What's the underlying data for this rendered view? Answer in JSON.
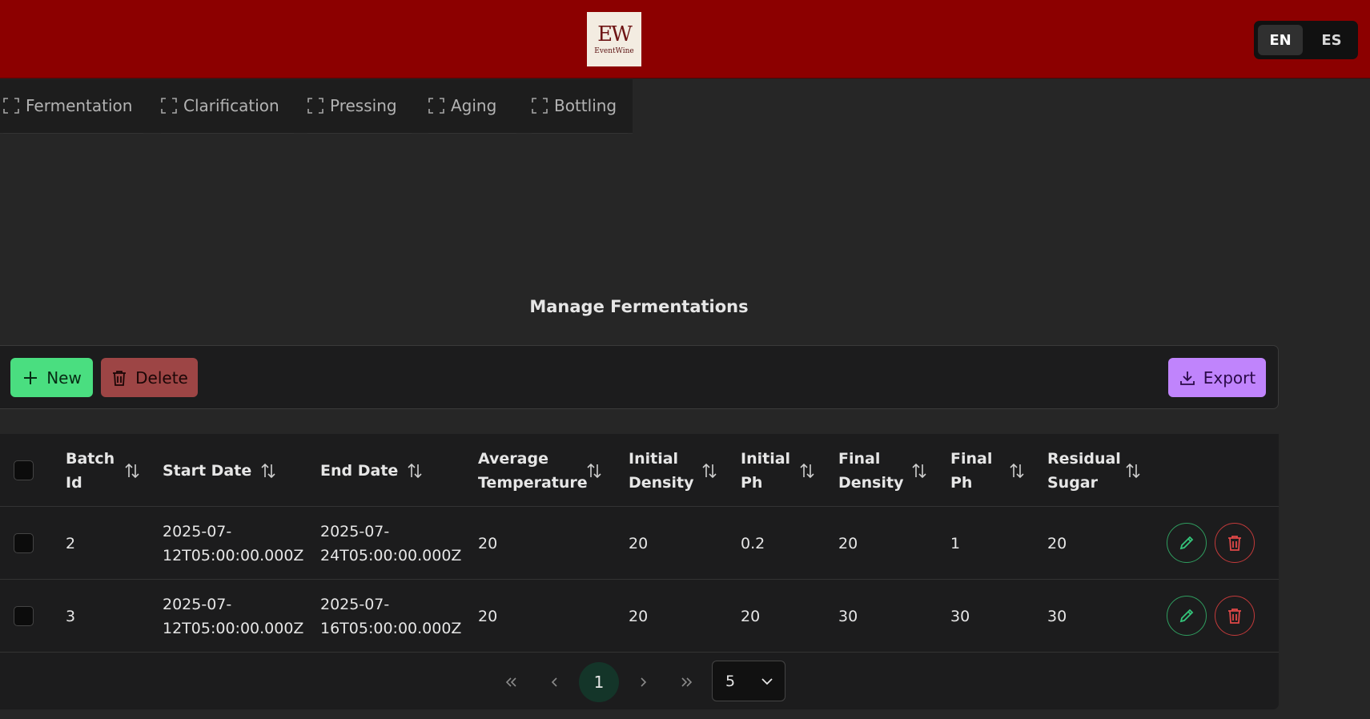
{
  "header": {
    "logo_mark": "EW",
    "logo_text": "EventWine",
    "languages": [
      "EN",
      "ES"
    ],
    "active_language": "EN"
  },
  "tabs": [
    "Fermentation",
    "Clarification",
    "Pressing",
    "Aging",
    "Bottling"
  ],
  "page_title": "Manage Fermentations",
  "toolbar": {
    "new_label": "New",
    "delete_label": "Delete",
    "export_label": "Export"
  },
  "table": {
    "columns": [
      "Batch Id",
      "Start Date",
      "End Date",
      "Average Temperature",
      "Initial Density",
      "Initial Ph",
      "Final Density",
      "Final Ph",
      "Residual Sugar"
    ],
    "rows": [
      [
        "2",
        "2025-07-12T05:00:00.000Z",
        "2025-07-24T05:00:00.000Z",
        "20",
        "20",
        "0.2",
        "20",
        "1",
        "20"
      ],
      [
        "3",
        "2025-07-12T05:00:00.000Z",
        "2025-07-16T05:00:00.000Z",
        "20",
        "20",
        "20",
        "30",
        "30",
        "30"
      ]
    ]
  },
  "pagination": {
    "current_page": "1",
    "page_size": "5"
  },
  "colors": {
    "header_bg": "#8c0000",
    "page_bg": "#262626",
    "new_button": "#4ade80",
    "delete_button": "#9d4545",
    "export_button": "#c084fc"
  }
}
